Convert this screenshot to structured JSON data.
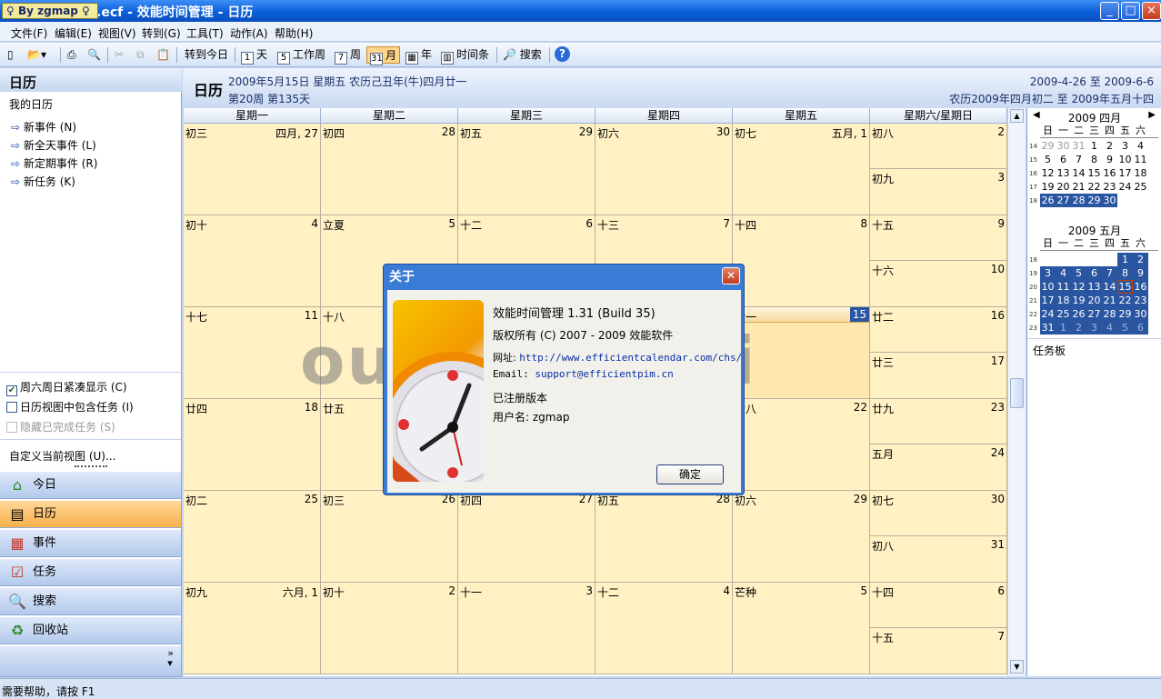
{
  "window": {
    "title": "我的时间管理.ecf - 效能时间管理 - 日历",
    "watermark_tag": "By zgmap",
    "minimize": "_",
    "maximize": "□",
    "close": "×"
  },
  "menu": [
    "文件(F)",
    "编辑(E)",
    "视图(V)",
    "转到(G)",
    "工具(T)",
    "动作(A)",
    "帮助(H)"
  ],
  "toolbar": {
    "today": "转到今日",
    "day": "天",
    "workweek": "工作周",
    "week": "周",
    "month": "月",
    "year": "年",
    "timeline": "时间条",
    "search": "搜索",
    "day_num": "1",
    "workweek_num": "5",
    "week_num": "7",
    "month_num": "31"
  },
  "sidebar": {
    "title": "日历",
    "my_calendar": "我的日历",
    "links": [
      "新事件 (N)",
      "新全天事件 (L)",
      "新定期事件 (R)",
      "新任务 (K)"
    ],
    "checks": [
      {
        "label": "周六周日紧凑显示 (C)",
        "checked": true
      },
      {
        "label": "日历视图中包含任务 (I)",
        "checked": false
      },
      {
        "label": "隐藏已完成任务 (S)",
        "checked": false
      }
    ],
    "customize": "自定义当前视图 (U)...",
    "nav": [
      "今日",
      "日历",
      "事件",
      "任务",
      "搜索",
      "回收站"
    ]
  },
  "header": {
    "title": "日历",
    "date_line": "2009年5月15日 星期五 农历己丑年(牛)四月廿一",
    "week_line": "第20周 第135天",
    "range": "2009-4-26 至 2009-6-6",
    "lunar_range": "农历2009年四月初二 至 2009年五月十四"
  },
  "weekdays": [
    "星期一",
    "星期二",
    "星期三",
    "星期四",
    "星期五",
    "星期六/星期日"
  ],
  "weeks": [
    {
      "days": [
        [
          "初三",
          "四月, 27"
        ],
        [
          "初四",
          "28"
        ],
        [
          "初五",
          "29"
        ],
        [
          "初六",
          "30"
        ],
        [
          "初七",
          "五月, 1"
        ]
      ],
      "sat": [
        "初八",
        "2"
      ],
      "sun": [
        "初九",
        "3"
      ]
    },
    {
      "days": [
        [
          "初十",
          "4"
        ],
        [
          "立夏",
          "5"
        ],
        [
          "十二",
          "6"
        ],
        [
          "十三",
          "7"
        ],
        [
          "十四",
          "8"
        ]
      ],
      "sat": [
        "十五",
        "9"
      ],
      "sun": [
        "十六",
        "10"
      ]
    },
    {
      "days": [
        [
          "十七",
          "11"
        ],
        [
          "十八",
          "12"
        ],
        [
          "",
          "13"
        ],
        [
          "",
          "14"
        ],
        [
          "廿一",
          "15"
        ]
      ],
      "sat": [
        "廿二",
        "16"
      ],
      "sun": [
        "廿三",
        "17"
      ]
    },
    {
      "days": [
        [
          "廿四",
          "18"
        ],
        [
          "廿五",
          "19"
        ],
        [
          "",
          "20"
        ],
        [
          "",
          "21"
        ],
        [
          "廿八",
          "22"
        ]
      ],
      "sat": [
        "廿九",
        "23"
      ],
      "sun": [
        "五月",
        "24"
      ]
    },
    {
      "days": [
        [
          "初二",
          "25"
        ],
        [
          "初三",
          "26"
        ],
        [
          "初四",
          "27"
        ],
        [
          "初五",
          "28"
        ],
        [
          "初六",
          "29"
        ]
      ],
      "sat": [
        "初七",
        "30"
      ],
      "sun": [
        "初八",
        "31"
      ]
    },
    {
      "days": [
        [
          "初九",
          "六月, 1"
        ],
        [
          "初十",
          "2"
        ],
        [
          "十一",
          "3"
        ],
        [
          "十二",
          "4"
        ],
        [
          "芒种",
          "5"
        ]
      ],
      "sat": [
        "十四",
        "6"
      ],
      "sun": [
        "十五",
        "7"
      ]
    }
  ],
  "minical": {
    "april_title": "2009 四月",
    "may_title": "2009 五月",
    "dow": [
      "日",
      "一",
      "二",
      "三",
      "四",
      "五",
      "六"
    ],
    "april_weeks": [
      "14",
      "15",
      "16",
      "17",
      "18"
    ],
    "april": [
      [
        "29",
        "30",
        "31",
        "1",
        "2",
        "3",
        "4"
      ],
      [
        "5",
        "6",
        "7",
        "8",
        "9",
        "10",
        "11"
      ],
      [
        "12",
        "13",
        "14",
        "15",
        "16",
        "17",
        "18"
      ],
      [
        "19",
        "20",
        "21",
        "22",
        "23",
        "24",
        "25"
      ],
      [
        "26",
        "27",
        "28",
        "29",
        "30",
        "",
        ""
      ]
    ],
    "may_weeks": [
      "18",
      "19",
      "20",
      "21",
      "22",
      "23"
    ],
    "may": [
      [
        "",
        "",
        "",
        "",
        "",
        "1",
        "2"
      ],
      [
        "3",
        "4",
        "5",
        "6",
        "7",
        "8",
        "9"
      ],
      [
        "10",
        "11",
        "12",
        "13",
        "14",
        "15",
        "16"
      ],
      [
        "17",
        "18",
        "19",
        "20",
        "21",
        "22",
        "23"
      ],
      [
        "24",
        "25",
        "26",
        "27",
        "28",
        "29",
        "30"
      ],
      [
        "31",
        "1",
        "2",
        "3",
        "4",
        "5",
        "6"
      ]
    ],
    "taskboard": "任务板"
  },
  "dialog": {
    "title": "关于",
    "app": "效能时间管理 1.31 (Build 35)",
    "copyright": "版权所有 (C) 2007 - 2009 效能软件",
    "url_label": "网址:",
    "url": "http://www.efficientcalendar.com/chs/",
    "email_label": "Email:",
    "email": "support@efficientpim.cn",
    "registered": "已注册版本",
    "user": "用户名: zgmap",
    "ok": "确定"
  },
  "status": "需要帮助，请按 F1",
  "overlay_text": "ouyaoxiazai",
  "colors": {
    "title_bar": "#0a5fd8",
    "cell": "#fff1c4",
    "accent": "#2a55a0",
    "today": "#2a55a0"
  }
}
